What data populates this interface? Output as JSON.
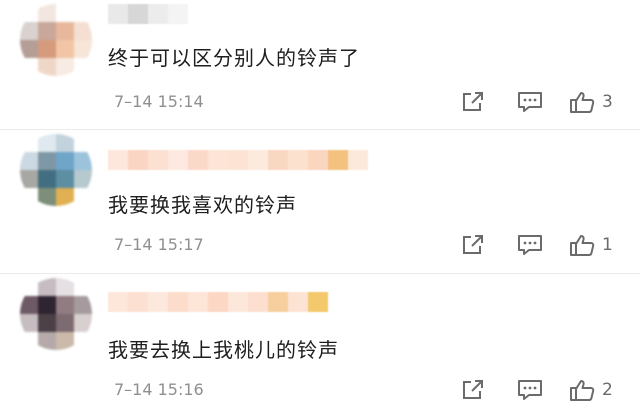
{
  "comments": [
    {
      "text": "终于可以区分别人的铃声了",
      "time": "7–14 15:14",
      "likes": "3",
      "avatar_colors": [
        "#ffffff",
        "#f2e7e0",
        "#ffffff",
        "#ffffff",
        "#d9d2cf",
        "#c9a89b",
        "#e7b89c",
        "#f4dfd2",
        "#b59e96",
        "#d69b7d",
        "#f2c5a6",
        "#f7e5d8",
        "#ffffff",
        "#efd7c8",
        "#f7ebe3",
        "#ffffff"
      ],
      "name_colors": [
        "#e9e9e9",
        "#d7d7d7",
        "#ececec",
        "#f4f4f4"
      ]
    },
    {
      "text": "我要换我喜欢的铃声",
      "time": "7–14 15:17",
      "likes": "1",
      "avatar_colors": [
        "#ffffff",
        "#dfe9ef",
        "#c3d3dd",
        "#ffffff",
        "#cbd9e3",
        "#7e97a6",
        "#6ea5c9",
        "#9cc3dc",
        "#a7a8a3",
        "#436e81",
        "#5d8ea2",
        "#b6c9cf",
        "#ffffff",
        "#7d8f7a",
        "#e0b052",
        "#ffffff"
      ],
      "name_colors": [
        "#fde7dc",
        "#fbd5c4",
        "#fce0d2",
        "#fde9df",
        "#fbd9c8",
        "#fde4d6",
        "#fce3d4",
        "#fdeadf",
        "#f9d8c1",
        "#fce1cf",
        "#fbd6bf",
        "#f4c27f",
        "#fde9dc"
      ]
    },
    {
      "text": "我要去换上我桃儿的铃声",
      "time": "7–14 15:16",
      "likes": "2",
      "avatar_colors": [
        "#ffffff",
        "#c6bcc1",
        "#e5e0e3",
        "#ffffff",
        "#6e5a66",
        "#2f2431",
        "#917c82",
        "#a59b9e",
        "#c5bdbf",
        "#4c4047",
        "#7c6b70",
        "#d8cfcf",
        "#ffffff",
        "#b5aaa9",
        "#cbb9a9",
        "#ffffff"
      ],
      "name_colors": [
        "#fde6da",
        "#fce0d2",
        "#fde8dd",
        "#fcdccb",
        "#fde5d8",
        "#fbd7c4",
        "#fde7db",
        "#fcdfcf",
        "#f7cf9f",
        "#fde3d3",
        "#f4c96c"
      ]
    }
  ],
  "icons": {
    "share": "share-icon",
    "comment": "comment-icon",
    "like": "thumbs-up-icon"
  },
  "colors": {
    "text": "#1e1e1e",
    "meta": "#8f8f8f",
    "icon": "#6b6b6b",
    "divider": "#ebebeb"
  }
}
